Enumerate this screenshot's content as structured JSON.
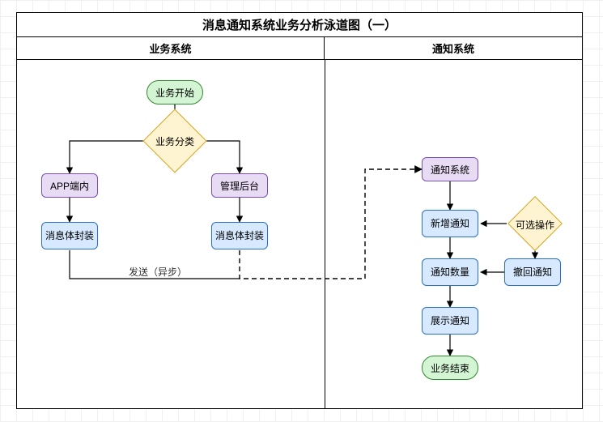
{
  "title": "消息通知系统业务分析泳道图（一）",
  "lanes": {
    "business": "业务系统",
    "notify": "通知系统"
  },
  "nodes": {
    "start": "业务开始",
    "classify": "业务分类",
    "app": "APP端内",
    "admin": "管理后台",
    "wrap1": "消息体封装",
    "wrap2": "消息体封装",
    "notify_sys": "通知系统",
    "add": "新增通知",
    "optional": "可选操作",
    "count": "通知数量",
    "recall": "撤回通知",
    "show": "展示通知",
    "end": "业务结束"
  },
  "edges": {
    "send_async": "发送（异步）"
  }
}
